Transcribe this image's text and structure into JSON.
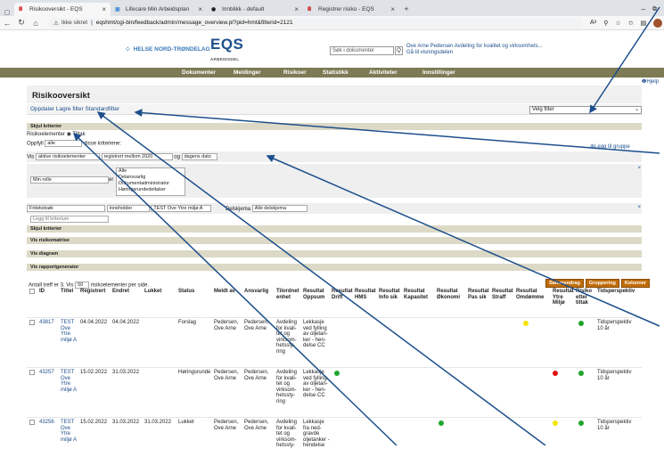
{
  "browser": {
    "tabs": [
      {
        "label": "Risikooversikt - EQS",
        "active": true
      },
      {
        "label": "Lifecare Min Arbeidsplan"
      },
      {
        "label": "Innblikk - default"
      },
      {
        "label": "Registrer risiko - EQS"
      }
    ],
    "new_tab": "+",
    "url_prefix": "Ikke sikret",
    "url": "eqshmt/cgi-bin/feedback/admin/message_overview.pl?pid=hmt&filterid=2121"
  },
  "app": {
    "logo_text": "HELSE NORD-TRØNDELAG",
    "eqs": "EQS",
    "eqs_sub": "ARBEIDSDEL",
    "search_placeholder": "Søk i dokumenter",
    "search_btn": "Q",
    "user_line1": "Ove Arne Pedersen  Avdeling for kvalitet og virksomhets...",
    "user_line2": "Gå til visningsdelen"
  },
  "menu": [
    "Dokumenter",
    "Meldinger",
    "Risikoer",
    "Statistikk",
    "Aktiviteter",
    "Innstillinger"
  ],
  "help": "Hjelp",
  "page_title": "Risikooversikt",
  "toolbar": {
    "refresh": "Oppdater",
    "save_filter": "Lagre filter",
    "default": "Standardfilter",
    "filter_select": "Velg filter"
  },
  "criteria": {
    "hide": "Skjul kriterier",
    "elements_label": "Risikoelementer",
    "tiltak": "Tiltak",
    "fulfill": "Oppfyll",
    "fulfill_val": "alle",
    "fulfill_suffix": "disse kriteriene:",
    "add_group": "Legg til gruppe",
    "show_label": "Vis",
    "show_val": "aktive risikoelementer",
    "reg_val": "registrert mellom 2020",
    "and": "og",
    "today": "dagens dato",
    "role_val": "Min rolle",
    "er": "er",
    "roles": [
      "Alle",
      "Delansvarlig",
      "Dokumentadministrator",
      "Høringsrundedeltaker"
    ],
    "freetext_val": "Fritekstsøk",
    "contains_val": "inneholder",
    "text_val": "TEST Ove Ytre miljø A",
    "delskjema_label": "Delskjema",
    "delskjema_val": "Alle delskjema",
    "add_criterion": "Legg til kriterium",
    "close": "×"
  },
  "sections": [
    "Skjul kriterier",
    "Vis risikomatrise",
    "Vis diagram",
    "Vis rapportgenerator"
  ],
  "buttons": [
    "Sammendrag",
    "Gruppering",
    "Kolonner"
  ],
  "count_text": "Antall treff er 3. Vis",
  "count_val": "50",
  "count_suffix": "risikoelementer per side.",
  "columns": [
    "ID",
    "Tittel",
    "Registrert",
    "Endret",
    "Lukket",
    "Status",
    "Meldt av",
    "Ansvarlig",
    "Tilordnet enhet",
    "Resultat Oppsum",
    "Resultat Drift",
    "Resultat HMS",
    "Resultat Info sik",
    "Resultat Kapasitet",
    "Resultat Økonomi",
    "Resultat Pas sik",
    "Resultat Straff",
    "Resultat Omdømme",
    "Resultat Ytre Miljø",
    "Risiko etter tiltak",
    "Tidsperspektiv"
  ],
  "rows": [
    {
      "id": "43817",
      "title": "TEST Ove Ytre miljø A",
      "reg": "04.04.2022",
      "endret": "04.04.2022",
      "lukket": "",
      "status": "Forslag",
      "meldt": "Pedersen, Ove Arne",
      "ansv": "Pedersen, Ove Arne",
      "enhet": "Avdeling for kvali-tet og virksom-hetssty-ring",
      "oppsum": "Lekkasje ved fylling av oljetan-ker - hen-delse CC",
      "tid": "Tidsperspektiv 10 år"
    },
    {
      "id": "43257",
      "title": "TEST Ove Ytre miljø A",
      "reg": "15.02.2022",
      "endret": "31.03.2022",
      "lukket": "",
      "status": "Høringsrunde",
      "meldt": "Pedersen, Ove Arne",
      "ansv": "Pedersen, Ove Arne",
      "enhet": "Avdeling for kvali-tet og virksom-hetssty-ring",
      "oppsum": "Lekkasje ved fylling av oljetan-ker - hen-delse CC",
      "tid": "Tidsperspektiv 10 år"
    },
    {
      "id": "43256",
      "title": "TEST Ove Ytre miljø A",
      "reg": "15.02.2022",
      "endret": "31.03.2022",
      "lukket": "31.03.2022",
      "status": "Lukket",
      "meldt": "Pedersen, Ove Arne",
      "ansv": "Pedersen, Ove Arne",
      "enhet": "Avdeling for kvali-tet og virksom-hetssty-",
      "oppsum": "Lekkasje fra ned-gravde oljetanker - hendelse",
      "tid": "Tidsperspektiv 10 år"
    }
  ],
  "colors": {
    "menubar": "#7d7a55",
    "section": "#dcd9c6",
    "button": "#c06c0a",
    "link": "#1d4f8b",
    "green": "#1fa52e",
    "yellow": "#f5e400",
    "red": "#e01010",
    "arrow": "#1d4f8b"
  }
}
